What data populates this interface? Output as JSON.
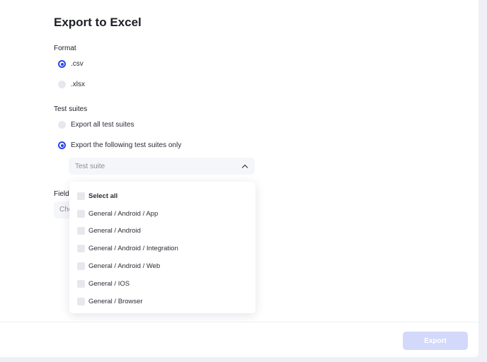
{
  "title": "Export to Excel",
  "format": {
    "label": "Format",
    "options": [
      {
        "label": ".csv",
        "selected": true
      },
      {
        "label": ".xlsx",
        "selected": false
      }
    ]
  },
  "test_suites": {
    "label": "Test suites",
    "options": [
      {
        "label": "Export all test suites",
        "selected": false
      },
      {
        "label": "Export the following test suites only",
        "selected": true
      }
    ],
    "select": {
      "placeholder": "Test suite",
      "icon": "chevron-up-icon"
    },
    "dropdown": [
      "Select all",
      "General / Android / App",
      "General / Android",
      "General / Android / Integration",
      "General / Android / Web",
      "General / IOS",
      "General / Browser"
    ]
  },
  "fields": {
    "label": "Fields",
    "placeholder": "Cho"
  },
  "export_label": "Export",
  "colors": {
    "accent": "#2745e8",
    "export_disabled": "#d2d9fb"
  }
}
